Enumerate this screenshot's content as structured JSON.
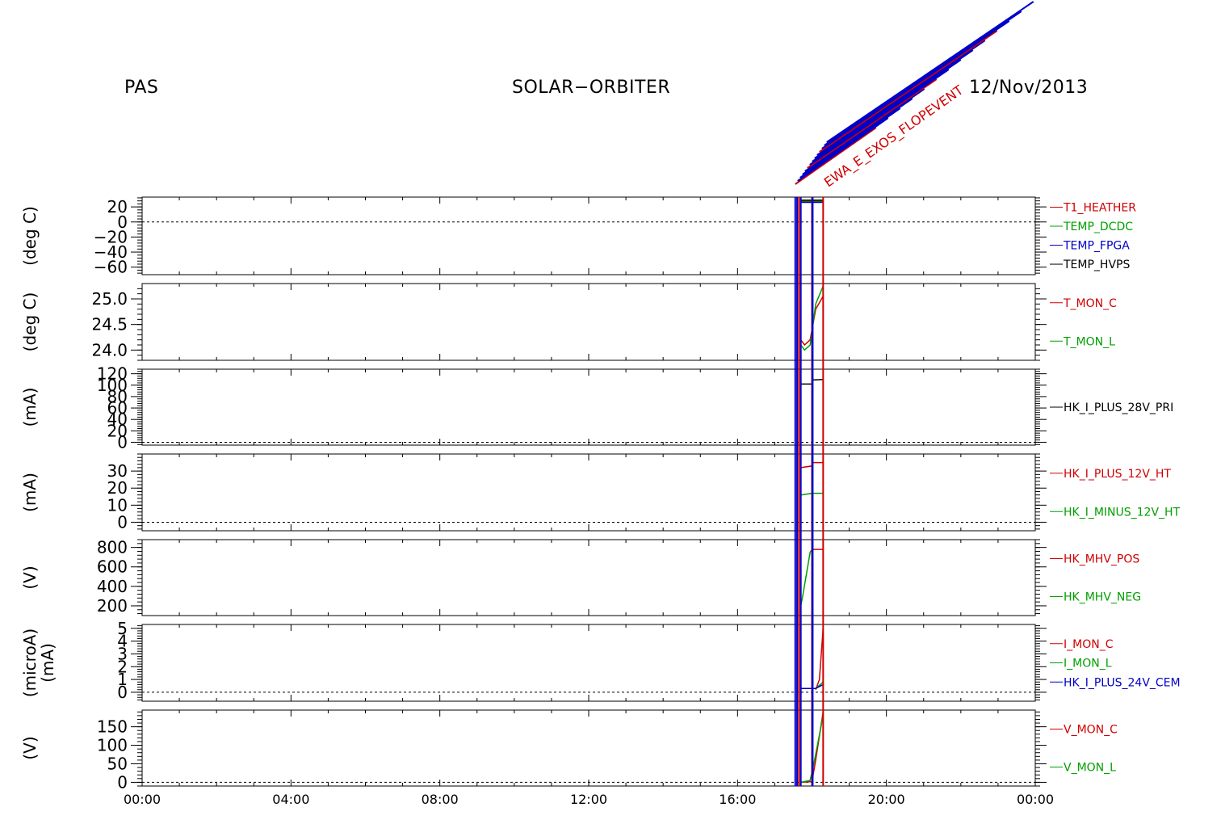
{
  "header": {
    "instrument": "PAS",
    "mission": "SOLAR−ORBITER",
    "date": "12/Nov/2013"
  },
  "colors": {
    "axis": "#000000",
    "red": "#d00000",
    "green": "#00a000",
    "blue": "#0000c8",
    "black": "#000000",
    "purple": "#6a0080"
  },
  "chart_data": [
    {
      "type": "line",
      "panel": 1,
      "ylabel": "(deg C)",
      "ylim": [
        -70,
        33
      ],
      "yticks": [
        20,
        0,
        -20,
        -40,
        -60
      ],
      "ytick_labels": [
        "20",
        "0",
        "−20",
        "−40",
        "−60"
      ],
      "zero_line": true,
      "series": [
        {
          "name": "T1_HEATHER",
          "color": "#d00000",
          "x": [
            17.7,
            18.3
          ],
          "values": [
            27,
            27
          ]
        },
        {
          "name": "TEMP_DCDC",
          "color": "#00a000",
          "x": [
            17.7,
            18.3
          ],
          "values": [
            28,
            28
          ]
        },
        {
          "name": "TEMP_FPGA",
          "color": "#0000c8",
          "x": [
            17.7,
            18.3
          ],
          "values": [
            26,
            26
          ]
        },
        {
          "name": "TEMP_HVPS",
          "color": "#000000",
          "x": [
            17.7,
            18.3
          ],
          "values": [
            29,
            29
          ]
        }
      ]
    },
    {
      "type": "line",
      "panel": 2,
      "ylabel": "(deg C)",
      "ylim": [
        23.8,
        25.3
      ],
      "yticks": [
        25.0,
        24.5,
        24.0
      ],
      "ytick_labels": [
        "25.0",
        "24.5",
        "24.0"
      ],
      "zero_line": false,
      "series": [
        {
          "name": "T_MON_C",
          "color": "#d00000",
          "x": [
            17.7,
            17.8,
            17.95,
            18.1,
            18.3
          ],
          "values": [
            24.2,
            24.1,
            24.2,
            24.8,
            25.05
          ]
        },
        {
          "name": "T_MON_L",
          "color": "#00a000",
          "x": [
            17.7,
            17.8,
            17.95,
            18.1,
            18.3
          ],
          "values": [
            24.1,
            24.0,
            24.1,
            24.9,
            25.25
          ]
        }
      ]
    },
    {
      "type": "line",
      "panel": 3,
      "ylabel": "(mA)",
      "ylim": [
        -5,
        128
      ],
      "yticks": [
        120,
        100,
        80,
        60,
        40,
        20,
        0
      ],
      "ytick_labels": [
        "120",
        "100",
        "80",
        "60",
        "40",
        "20",
        "0"
      ],
      "zero_line": true,
      "series": [
        {
          "name": "HK_I_PLUS_28V_PRI",
          "color": "#000000",
          "x": [
            17.7,
            18.0,
            18.0,
            18.3
          ],
          "values": [
            102,
            102,
            109,
            110
          ]
        }
      ]
    },
    {
      "type": "line",
      "panel": 4,
      "ylabel": "(mA)",
      "ylim": [
        -5,
        40
      ],
      "yticks": [
        30,
        20,
        10,
        0
      ],
      "ytick_labels": [
        "30",
        "20",
        "10",
        "0"
      ],
      "zero_line": true,
      "series": [
        {
          "name": "HK_I_PLUS_12V_HT",
          "color": "#d00000",
          "x": [
            17.7,
            18.0,
            18.0,
            18.3
          ],
          "values": [
            32,
            33,
            35,
            35
          ]
        },
        {
          "name": "HK_I_MINUS_12V_HT",
          "color": "#00a000",
          "x": [
            17.7,
            18.0,
            18.3
          ],
          "values": [
            16,
            17,
            17
          ]
        }
      ]
    },
    {
      "type": "line",
      "panel": 5,
      "ylabel": "(V)",
      "ylim": [
        100,
        880
      ],
      "yticks": [
        800,
        600,
        400,
        200
      ],
      "ytick_labels": [
        "800",
        "600",
        "400",
        "200"
      ],
      "zero_line": false,
      "series": [
        {
          "name": "HK_MHV_POS",
          "color": "#d00000",
          "x": [
            18.0,
            18.0,
            18.3
          ],
          "values": [
            180,
            780,
            780
          ]
        },
        {
          "name": "HK_MHV_NEG",
          "color": "#00a000",
          "x": [
            17.7,
            17.75,
            17.95,
            18.0
          ],
          "values": [
            200,
            300,
            750,
            780
          ]
        }
      ]
    },
    {
      "type": "line",
      "panel": 6,
      "ylabel": "(microA)",
      "ylabel2": "(mA)",
      "ylim": [
        -0.7,
        5.3
      ],
      "yticks": [
        5,
        4,
        3,
        2,
        1,
        0
      ],
      "ytick_labels": [
        "5",
        "4",
        "3",
        "2",
        "1",
        "0"
      ],
      "zero_line": true,
      "series": [
        {
          "name": "I_MON_C",
          "color": "#d00000",
          "x": [
            18.1,
            18.2,
            18.3
          ],
          "values": [
            0.2,
            1.0,
            5.0
          ]
        },
        {
          "name": "I_MON_L",
          "color": "#00a000",
          "x": [
            17.7,
            18.1,
            18.3
          ],
          "values": [
            0.3,
            0.3,
            0.8
          ]
        },
        {
          "name": "HK_I_PLUS_24V_CEM",
          "color": "#0000c8",
          "x": [
            17.7,
            18.1,
            18.3
          ],
          "values": [
            0.3,
            0.3,
            0.6
          ]
        }
      ]
    },
    {
      "type": "line",
      "panel": 7,
      "ylabel": "(V)",
      "ylim": [
        -10,
        195
      ],
      "yticks": [
        150,
        100,
        50,
        0
      ],
      "ytick_labels": [
        "150",
        "100",
        "50",
        "0"
      ],
      "zero_line": true,
      "series": [
        {
          "name": "V_MON_C",
          "color": "#d00000",
          "x": [
            17.7,
            18.0,
            18.1,
            18.3
          ],
          "values": [
            0,
            2,
            60,
            190
          ]
        },
        {
          "name": "V_MON_L",
          "color": "#00a000",
          "x": [
            17.7,
            17.95,
            18.05,
            18.3
          ],
          "values": [
            0,
            5,
            50,
            180
          ]
        }
      ]
    }
  ],
  "x_axis": {
    "xlim": [
      0,
      24
    ],
    "major_ticks": [
      0,
      4,
      8,
      12,
      16,
      20,
      24
    ],
    "tick_labels": [
      "00:00",
      "04:00",
      "08:00",
      "12:00",
      "16:00",
      "20:00",
      "00:00"
    ],
    "minor_step": 1
  },
  "event_markers": [
    {
      "x": 17.55,
      "color": "#0000c8"
    },
    {
      "x": 17.6,
      "color": "#0000c8"
    },
    {
      "x": 17.65,
      "color": "#d00000"
    },
    {
      "x": 17.7,
      "color": "#0000c8"
    },
    {
      "x": 18.0,
      "color": "#6a0080"
    },
    {
      "x": 18.02,
      "color": "#0000c8"
    },
    {
      "x": 18.3,
      "color": "#d00000"
    }
  ],
  "event_labels": {
    "visible_text": "EWA_E_EXOS_FLOPEVENT"
  }
}
